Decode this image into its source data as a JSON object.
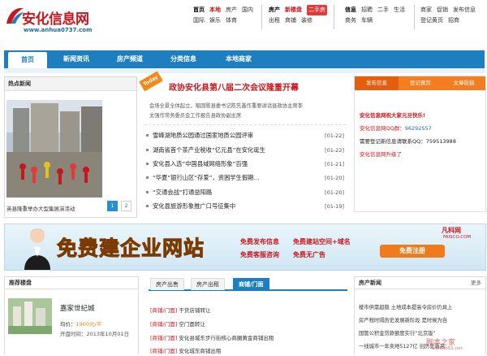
{
  "logo": {
    "name": "安化信息网",
    "url": "www.anhua0737.com"
  },
  "topnav": [
    {
      "rows": [
        [
          "首页",
          "本地",
          "房产",
          "国内"
        ],
        [
          "国际",
          "娱乐",
          "体育"
        ]
      ]
    },
    {
      "rows": [
        [
          "房产",
          "新楼盘",
          "二手房"
        ],
        [
          "出租",
          "商铺",
          "装修"
        ]
      ]
    },
    {
      "rows": [
        [
          "信息",
          "招聘",
          "二手",
          "生活"
        ],
        [
          "商务",
          "车辆"
        ]
      ]
    },
    {
      "rows": [
        [
          "商家",
          "促销",
          "发布信息"
        ],
        [
          "登记黄页",
          "招商"
        ]
      ]
    }
  ],
  "mainnav": {
    "tabs": [
      "首页",
      "新闻资讯",
      "房产频道",
      "分类信息",
      "本地商家"
    ]
  },
  "hotnews": {
    "title": "热点新闻",
    "caption": "英县隆重举办大型集展演活动",
    "pages": [
      "1",
      "2"
    ]
  },
  "headline": {
    "badge": "Today",
    "title": "政协安化县第八届二次会议隆重开幕",
    "summary_a": "会场全景全体起立，唱国歌县委书记陈先鑫作重要讲话县政协主席李",
    "summary_b": "太强作常务委员会工作报告县政协副主席",
    "news": [
      {
        "title": "雪峰湖地质公园通过国家地质公园评审",
        "date": "[01-22]"
      },
      {
        "title": "湖南省首个茶产业税收“亿元县”在安化诞生",
        "date": "[01-22]"
      },
      {
        "title": "安化县入选“中国县域网络形象”百强",
        "date": "[01-21]"
      },
      {
        "title": "“华夏”银行山区“存爱”，资困学生假期...",
        "date": "[01-20]"
      },
      {
        "title": "“交通会战”打通益阳路",
        "date": "[01-20]"
      },
      {
        "title": "安化县旅游形象推广口号征集中",
        "date": "[01-19]"
      }
    ]
  },
  "rightbox": {
    "tabs": [
      "发布信息",
      "登记黄页",
      "文章投稿"
    ],
    "welcome": "安化信息网祝大家元旦快乐!",
    "qq_label": "安化信息网QQ群：",
    "qq_value": "96292557",
    "contact": "需要登记新信息请联系QQ：759513988",
    "upgrade": "安化信息网升级了"
  },
  "banner": {
    "headline": "免费建企业网站",
    "items": [
      "免费发布信息",
      "免费建站空间+域名",
      "免费客服咨询",
      "免费无广告"
    ],
    "register": "免费注册",
    "brand": "凡科网",
    "brand_url": "FAISCO.COM"
  },
  "recommend": {
    "title": "推荐楼盘",
    "name": "嘉家世纪城",
    "price_label": "均价：",
    "price": "1900元/平",
    "time_label": "开盘时间：",
    "time": "2013年10月01日"
  },
  "midtabs": {
    "tabs": [
      "房产出售",
      "房产出租",
      "商铺/门面"
    ],
    "rows": [
      {
        "tag": "[商铺/门面]",
        "text": "干货店铺转让"
      },
      {
        "tag": "[商铺/门面]",
        "text": "空门面转让"
      },
      {
        "tag": "[商铺/门面]",
        "text": "安化县城东步行街核心商圈黄金商铺出租"
      },
      {
        "tag": "[商铺/门面]",
        "text": "安化城东商铺出租"
      }
    ]
  },
  "newsbox": {
    "title": "房产新闻",
    "more": "更多",
    "rows": [
      "楼市供需趋稳 土地成本提高令房价仍具上",
      "房产税时隔历史发展新阶段 是时候为自",
      "国管公积金贷款额度实行“北京版”",
      "一线城市一年卖地5127亿 创历史新高"
    ]
  },
  "watermark": {
    "text": "脚本之家",
    "url": "www.jb51.net"
  }
}
